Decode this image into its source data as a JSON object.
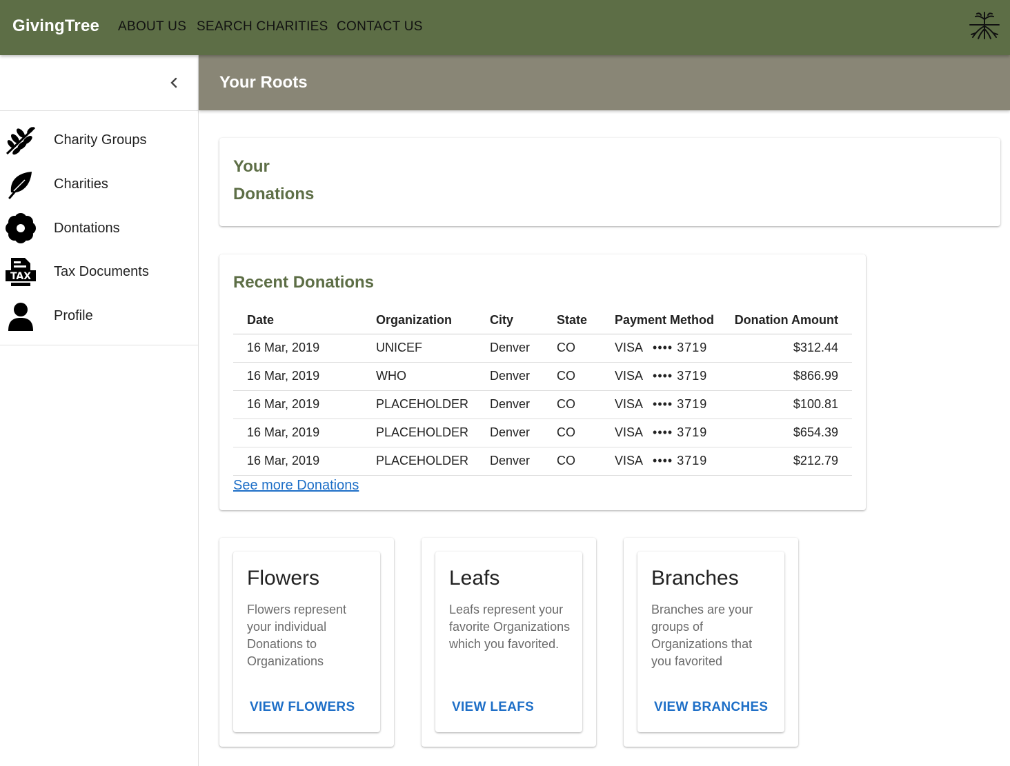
{
  "appbar": {
    "brand": "GivingTree",
    "nav": [
      "ABOUT US",
      "SEARCH CHARITIES",
      "CONTACT US"
    ],
    "logo_icon": "tree-roots-icon",
    "color": "#5d6e46"
  },
  "sidebar": {
    "collapse_icon": "chevron-left-icon",
    "items": [
      {
        "label": "Charity Groups",
        "icon": "branch-icon"
      },
      {
        "label": "Charities",
        "icon": "leaf-icon"
      },
      {
        "label": "Dontations",
        "icon": "flower-icon"
      },
      {
        "label": "Tax Documents",
        "icon": "tax-document-icon"
      },
      {
        "label": "Profile",
        "icon": "person-icon"
      }
    ]
  },
  "header": {
    "title": "Your Roots",
    "color": "#898676"
  },
  "donations_card": {
    "line1": "Your",
    "line2": "Donations"
  },
  "recent": {
    "title": "Recent Donations",
    "columns": [
      "Date",
      "Organization",
      "City",
      "State",
      "Payment Method",
      "Donation Amount"
    ],
    "rows": [
      {
        "date": "16 Mar, 2019",
        "org": "UNICEF",
        "city": "Denver",
        "state": "CO",
        "card": "VISA",
        "last4": "•••• 3719",
        "amount": "$312.44"
      },
      {
        "date": "16 Mar, 2019",
        "org": "WHO",
        "city": "Denver",
        "state": "CO",
        "card": "VISA",
        "last4": "•••• 3719",
        "amount": "$866.99"
      },
      {
        "date": "16 Mar, 2019",
        "org": "PLACEHOLDER",
        "city": "Denver",
        "state": "CO",
        "card": "VISA",
        "last4": "•••• 3719",
        "amount": "$100.81"
      },
      {
        "date": "16 Mar, 2019",
        "org": "PLACEHOLDER",
        "city": "Denver",
        "state": "CO",
        "card": "VISA",
        "last4": "•••• 3719",
        "amount": "$654.39"
      },
      {
        "date": "16 Mar, 2019",
        "org": "PLACEHOLDER",
        "city": "Denver",
        "state": "CO",
        "card": "VISA",
        "last4": "•••• 3719",
        "amount": "$212.79"
      }
    ],
    "see_more": "See more Donations"
  },
  "cards": [
    {
      "title": "Flowers",
      "text": "Flowers represent your individual Donations to Organizations",
      "action": "VIEW FLOWERS"
    },
    {
      "title": "Leafs",
      "text": "Leafs represent your favorite Organizations which you favorited.",
      "action": "VIEW LEAFS"
    },
    {
      "title": "Branches",
      "text": "Branches are your groups of Organizations that you favorited",
      "action": "VIEW BRANCHES"
    }
  ],
  "accent_color": "#1e6fc7"
}
